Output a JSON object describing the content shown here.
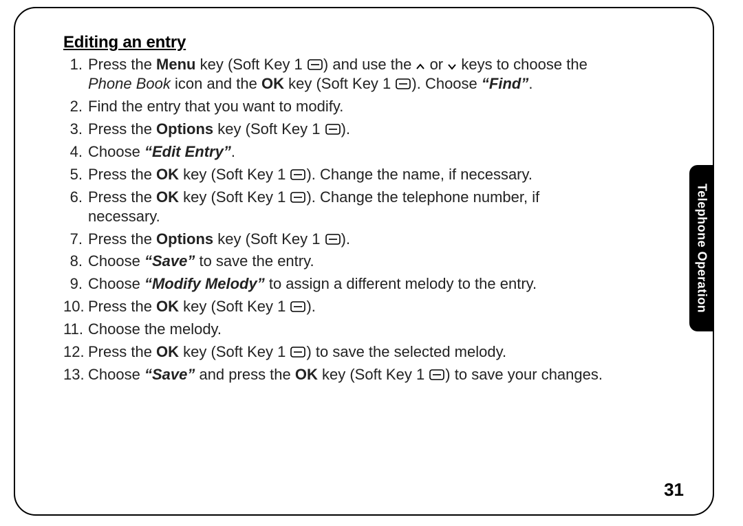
{
  "section": {
    "heading": "Editing an entry"
  },
  "steps": {
    "s1a": "Press the ",
    "s1_menu": "Menu",
    "s1b": " key (Soft Key 1 ",
    "s1c": ") and use the ",
    "s1d": " or ",
    "s1e": " keys to choose the ",
    "s1_pb": "Phone Book",
    "s1f": " icon and the ",
    "s1_ok": "OK",
    "s1g": " key (Soft Key 1 ",
    "s1h": "). Choose ",
    "s1_find": "“Find”",
    "s1i": ".",
    "s2": "Find the entry that you want to modify.",
    "s3a": "Press the ",
    "s3_opt": "Options",
    "s3b": " key (Soft Key 1 ",
    "s3c": ").",
    "s4a": "Choose ",
    "s4_edit": "“Edit Entry”",
    "s4b": ".",
    "s5a": "Press the ",
    "s5_ok": "OK",
    "s5b": " key (Soft Key 1 ",
    "s5c": "). Change the name, if necessary.",
    "s6a": "Press the ",
    "s6_ok": "OK",
    "s6b": " key (Soft Key 1 ",
    "s6c": "). Change the telephone num­ber, if necessary.",
    "s7a": "Press the ",
    "s7_opt": "Options",
    "s7b": " key (Soft Key 1 ",
    "s7c": ").",
    "s8a": "Choose ",
    "s8_save": "“Save”",
    "s8b": " to save the entry.",
    "s9a": "Choose ",
    "s9_mm": "“Modify Melody”",
    "s9b": " to assign a different melody to the entry.",
    "s10a": "Press the ",
    "s10_ok": "OK",
    "s10b": " key (Soft Key 1 ",
    "s10c": ").",
    "s11": "Choose the melody.",
    "s12a": "Press the ",
    "s12_ok": "OK",
    "s12b": " key (Soft Key 1 ",
    "s12c": ") to save the selected melody.",
    "s13a": "Choose ",
    "s13_save": "“Save”",
    "s13b": " and press the ",
    "s13_ok": "OK",
    "s13c": " key (Soft Key 1 ",
    "s13d": ") to save your changes."
  },
  "tab": {
    "label": "Telephone Operation"
  },
  "page": {
    "number": "31"
  }
}
